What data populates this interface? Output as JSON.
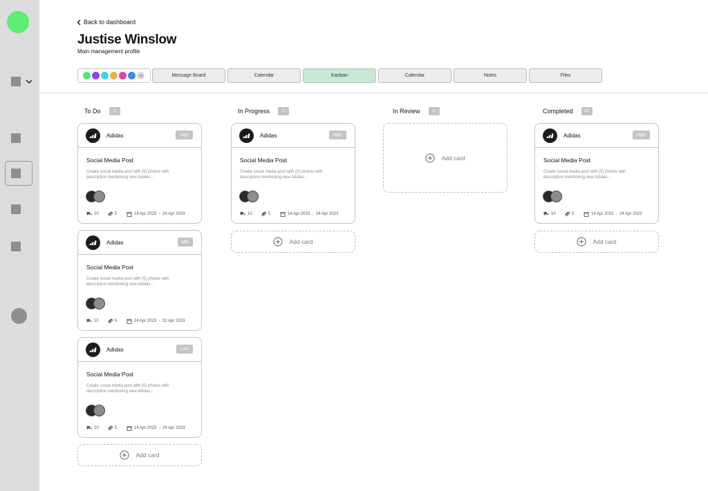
{
  "nav": {
    "back_label": "Back to dashboard"
  },
  "profile": {
    "name": "Justise Winslow",
    "subtitle": "Main management profile"
  },
  "members": {
    "colors": [
      "#4de86a",
      "#9a3de8",
      "#39d4e8",
      "#e8b33d",
      "#e83da8",
      "#3d8de8"
    ],
    "more_label": "+99"
  },
  "tabs": [
    {
      "label": "Message Board",
      "active": false
    },
    {
      "label": "Calendar",
      "active": false
    },
    {
      "label": "Kanban",
      "active": true
    },
    {
      "label": "Calendar",
      "active": false
    },
    {
      "label": "Notes",
      "active": false
    },
    {
      "label": "Files",
      "active": false
    }
  ],
  "columns": [
    {
      "title": "To Do",
      "count": "3"
    },
    {
      "title": "In Progress",
      "count": "2"
    },
    {
      "title": "In Review",
      "count": "0"
    },
    {
      "title": "Completed",
      "count": "10"
    }
  ],
  "cards": [
    {
      "brand": "Adidas",
      "priority": "High",
      "title": "Social Media Post",
      "desc": "Create social media post with (5) photos with description mentioning new Adidas...",
      "comments": "10",
      "attachments": "5",
      "dates": "14 Apr 2023  -  24 Apr 2023"
    },
    {
      "brand": "Adidas",
      "priority": "Mid",
      "title": "Social Media Post",
      "desc": "Create social media post with (5) photos with description mentioning new Adidas...",
      "comments": "10",
      "attachments": "5",
      "dates": "24 Apr 2023  -  31 Apr 2023"
    },
    {
      "brand": "Adidas",
      "priority": "Low",
      "title": "Social Media Post",
      "desc": "Create social media post with (5) photos with description mentioning new Adidas...",
      "comments": "10",
      "attachments": "5",
      "dates": "14 Apr 2023  -  24 Apr 2023"
    },
    {
      "brand": "Adidas",
      "priority": "High",
      "title": "Social Media Post",
      "desc": "Create social media post with (5) photos with description mentioning new Adidas...",
      "comments": "10",
      "attachments": "5",
      "dates": "14 Apr 2023  -  24 Apr 2023"
    },
    {
      "brand": "Adidas",
      "priority": "High",
      "title": "Social Media Post",
      "desc": "Create social media post with (5) photos with description mentioning new Adidas...",
      "comments": "10",
      "attachments": "5",
      "dates": "14 Apr 2023  -  24 Apr 2023"
    }
  ],
  "add_card_label": "Add card",
  "icons": {
    "back": "chevron-left-icon",
    "comment": "comment-icon",
    "attachment": "paperclip-icon",
    "calendar": "calendar-icon",
    "add": "plus-circle-icon",
    "brand": "adidas-logo-icon"
  }
}
